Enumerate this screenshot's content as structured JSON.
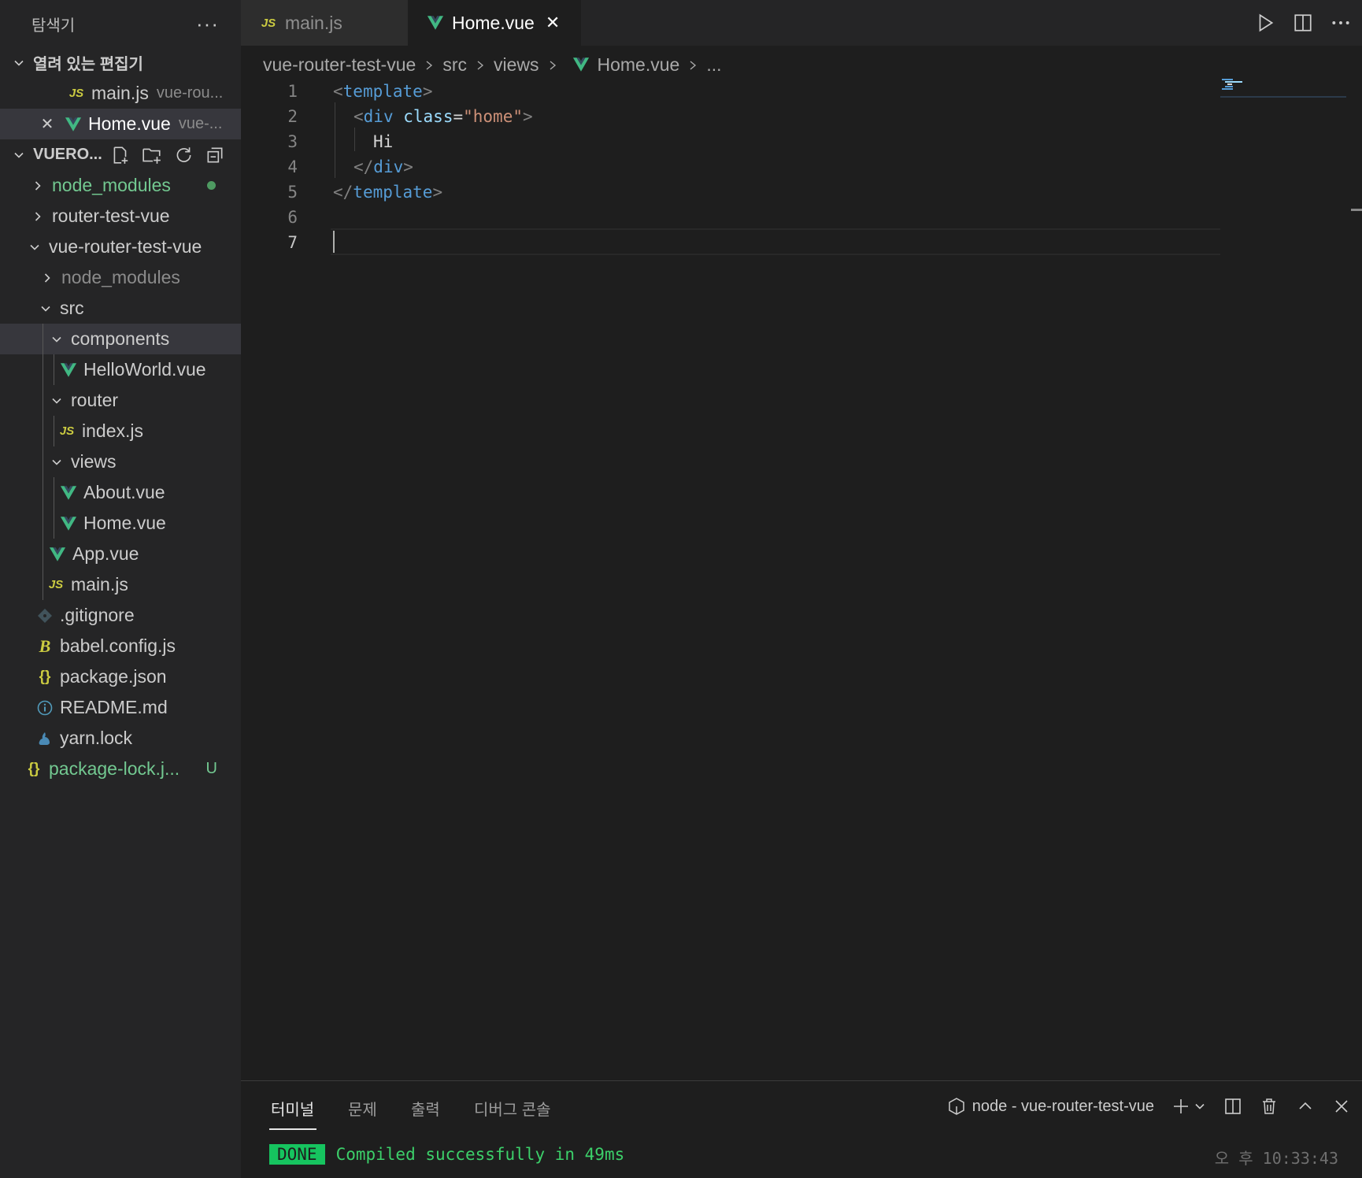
{
  "sidebar": {
    "title": "탐색기",
    "more": "···",
    "open_editors": {
      "label": "열려 있는 편집기",
      "items": [
        {
          "name": "main.js",
          "desc": "vue-rou...",
          "icon": "js-icon"
        },
        {
          "name": "Home.vue",
          "desc": "vue-...",
          "icon": "vue-icon"
        }
      ]
    },
    "workspace": {
      "label": "VUERO...",
      "tree": [
        {
          "name": "node_modules"
        },
        {
          "name": "router-test-vue"
        },
        {
          "name": "vue-router-test-vue"
        },
        {
          "name": "node_modules"
        },
        {
          "name": "src"
        },
        {
          "name": "components"
        },
        {
          "name": "HelloWorld.vue"
        },
        {
          "name": "router"
        },
        {
          "name": "index.js"
        },
        {
          "name": "views"
        },
        {
          "name": "About.vue"
        },
        {
          "name": "Home.vue"
        },
        {
          "name": "App.vue"
        },
        {
          "name": "main.js"
        },
        {
          "name": ".gitignore"
        },
        {
          "name": "babel.config.js"
        },
        {
          "name": "package.json"
        },
        {
          "name": "README.md"
        },
        {
          "name": "yarn.lock"
        },
        {
          "name": "package-lock.j...",
          "badge": "U"
        }
      ]
    }
  },
  "tabs": [
    {
      "label": "main.js",
      "icon": "js-icon"
    },
    {
      "label": "Home.vue",
      "icon": "vue-icon",
      "close": "✕"
    }
  ],
  "breadcrumb": [
    "vue-router-test-vue",
    "src",
    "views",
    "Home.vue",
    "..."
  ],
  "editor": {
    "line_numbers": [
      "1",
      "2",
      "3",
      "4",
      "5",
      "6",
      "7"
    ],
    "l1": {
      "open": "<",
      "tag": "template",
      "close": ">"
    },
    "l2": {
      "open": "<",
      "tag": "div",
      "attr": "class",
      "eq": "=",
      "value": "\"home\"",
      "close": ">"
    },
    "l3": {
      "text": "Hi"
    },
    "l4": {
      "open": "</",
      "tag": "div",
      "close": ">"
    },
    "l5": {
      "open": "</",
      "tag": "template",
      "close": ">"
    }
  },
  "panel": {
    "tabs": [
      "터미널",
      "문제",
      "출력",
      "디버그 콘솔"
    ],
    "terminal_name": "node - vue-router-test-vue",
    "done_label": "DONE",
    "message": "Compiled successfully in 49ms",
    "time": "오 후  10:33:43"
  },
  "colors": {
    "vue_green": "#41b883",
    "js_yellow": "#cbcb41",
    "git_untracked": "#73c991",
    "done_badge": "#16c45f"
  }
}
